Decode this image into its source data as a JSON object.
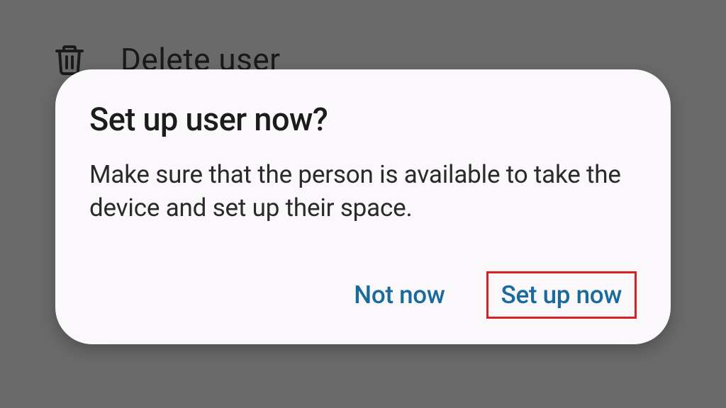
{
  "background": {
    "delete_user_label": "Delete user"
  },
  "dialog": {
    "title": "Set up user now?",
    "message": "Make sure that the person is available to take the device and set up their space.",
    "actions": {
      "not_now": "Not now",
      "set_up_now": "Set up now"
    }
  },
  "colors": {
    "accent": "#1a6a9e",
    "highlight": "#d92020",
    "backdrop": "#6a6a6a",
    "surface": "#faf8fa"
  }
}
